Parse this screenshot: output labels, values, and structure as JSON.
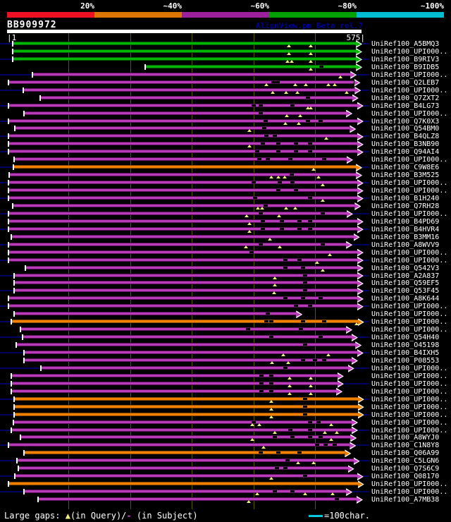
{
  "header": {
    "accession": "BB909972",
    "watermark": "AlignView.pm Beta rel.7",
    "scale_segments": [
      {
        "label": "20%",
        "color": "#ef1024"
      },
      {
        "label": "~40%",
        "color": "#dd7600"
      },
      {
        "label": "~60%",
        "color": "#9c1f9c"
      },
      {
        "label": "~80%",
        "color": "#00a000"
      },
      {
        "label": "~100%",
        "color": "#00bcd0"
      }
    ]
  },
  "ruler": {
    "start_label": "|1",
    "end_label": "575|",
    "query_length": 575,
    "tick_interval_chars": 100
  },
  "footer": {
    "gaps_prefix": "Large gaps: ",
    "gap_query_symbol": "▲",
    "gaps_mid": "(in Query)/",
    "gap_subject_symbol": "-",
    "gaps_suffix": " (in Subject)",
    "scale_legend_label": "=100char."
  },
  "chart_data": {
    "type": "alignment-overview",
    "title": "BB909972 BLAST hit overview",
    "query_length": 575,
    "x_axis": {
      "start": 1,
      "end": 575,
      "gridline_positions": [
        100,
        200,
        300,
        400,
        500
      ]
    },
    "color_meaning": {
      "green": "~80% identity",
      "purple": "~60% identity",
      "orange": "~40% identity"
    },
    "legend_scale_chars": 100,
    "gap_semantics": {
      "triangle": "large gap in Query",
      "dash": "large gap in Subject"
    },
    "rows": [
      {
        "label": "UniRef100_A5BMQ3",
        "color": "green",
        "start": 10,
        "end": 566,
        "gaps_query": [
          457,
          493
        ],
        "gaps_subject": []
      },
      {
        "label": "UniRef100_UPI000..",
        "color": "green",
        "start": 10,
        "end": 566,
        "gaps_query": [
          457,
          493
        ],
        "gaps_subject": []
      },
      {
        "label": "UniRef100_B9RIV3",
        "color": "green",
        "start": 10,
        "end": 566,
        "gaps_query": [
          455,
          462,
          493
        ],
        "gaps_subject": []
      },
      {
        "label": "UniRef100_B9IDB5",
        "color": "green",
        "start": 225,
        "end": 566,
        "gaps_query": [
          493
        ],
        "gaps_subject": [
          510
        ]
      },
      {
        "label": "UniRef100_UPI000..",
        "color": "purple",
        "start": 42,
        "end": 557,
        "gaps_query": [
          541
        ],
        "gaps_subject": []
      },
      {
        "label": "UniRef100_Q2LEB7",
        "color": "purple",
        "start": 3,
        "end": 563,
        "gaps_query": [
          421,
          468,
          485,
          521,
          531
        ],
        "gaps_subject": [
          432,
          439
        ]
      },
      {
        "label": "UniRef100_UPI000..",
        "color": "purple",
        "start": 27,
        "end": 564,
        "gaps_query": [
          431,
          453,
          471,
          551
        ],
        "gaps_subject": []
      },
      {
        "label": "UniRef100_Q7ZXT2",
        "color": "purple",
        "start": 55,
        "end": 560,
        "gaps_query": [],
        "gaps_subject": [
          488
        ]
      },
      {
        "label": "UniRef100_B4LG73",
        "color": "purple",
        "start": 3,
        "end": 568,
        "gaps_query": [
          488,
          493
        ],
        "gaps_subject": [
          400,
          412,
          463
        ]
      },
      {
        "label": "UniRef100_UPI000..",
        "color": "purple",
        "start": 29,
        "end": 550,
        "gaps_query": [
          454,
          476
        ],
        "gaps_subject": [
          412
        ]
      },
      {
        "label": "UniRef100_Q7K0X3",
        "color": "purple",
        "start": 3,
        "end": 568,
        "gaps_query": [
          452,
          473
        ],
        "gaps_subject": [
          420,
          488,
          509
        ]
      },
      {
        "label": "UniRef100_Q54BM0",
        "color": "purple",
        "start": 14,
        "end": 556,
        "gaps_query": [
          393
        ],
        "gaps_subject": [
          417
        ]
      },
      {
        "label": "UniRef100_B4QLZ8",
        "color": "purple",
        "start": 3,
        "end": 568,
        "gaps_query": [
          518
        ],
        "gaps_subject": [
          421,
          434
        ]
      },
      {
        "label": "UniRef100_B3NB90",
        "color": "purple",
        "start": 3,
        "end": 568,
        "gaps_query": [
          393
        ],
        "gaps_subject": [
          415,
          440,
          469,
          492
        ]
      },
      {
        "label": "UniRef100_Q94AI4",
        "color": "purple",
        "start": 3,
        "end": 568,
        "gaps_query": [],
        "gaps_subject": [
          406,
          440,
          469,
          492
        ]
      },
      {
        "label": "UniRef100_UPI000..",
        "color": "purple",
        "start": 13,
        "end": 551,
        "gaps_query": [],
        "gaps_subject": [
          409,
          423,
          460,
          514
        ]
      },
      {
        "label": "UniRef100_C9W8E6",
        "color": "orange",
        "start": 11,
        "end": 566,
        "gaps_query": [
          497
        ],
        "gaps_subject": []
      },
      {
        "label": "UniRef100_B3M525",
        "color": "purple",
        "start": 5,
        "end": 566,
        "gaps_query": [
          429,
          440,
          450,
          505
        ],
        "gaps_subject": [
          462
        ]
      },
      {
        "label": "UniRef100_UPI000..",
        "color": "purple",
        "start": 3,
        "end": 568,
        "gaps_query": [
          512
        ],
        "gaps_subject": [
          400,
          442,
          463
        ]
      },
      {
        "label": "UniRef100_UPI000..",
        "color": "purple",
        "start": 3,
        "end": 568,
        "gaps_query": [],
        "gaps_subject": [
          440,
          469
        ]
      },
      {
        "label": "UniRef100_B1H240",
        "color": "purple",
        "start": 3,
        "end": 568,
        "gaps_query": [
          512
        ],
        "gaps_subject": [
          402,
          492
        ]
      },
      {
        "label": "UniRef100_Q7RH28",
        "color": "purple",
        "start": 10,
        "end": 564,
        "gaps_query": [
          407,
          414,
          453,
          468
        ],
        "gaps_subject": [
          420
        ]
      },
      {
        "label": "UniRef100_UPI000..",
        "color": "purple",
        "start": 3,
        "end": 551,
        "gaps_query": [
          389,
          441
        ],
        "gaps_subject": [
          412,
          512
        ]
      },
      {
        "label": "UniRef100_B4PD69",
        "color": "purple",
        "start": 3,
        "end": 568,
        "gaps_query": [
          393
        ],
        "gaps_subject": [
          415,
          446,
          474,
          492
        ]
      },
      {
        "label": "UniRef100_B4HVR4",
        "color": "purple",
        "start": 3,
        "end": 568,
        "gaps_query": [
          393
        ],
        "gaps_subject": [
          415,
          446,
          474,
          492
        ]
      },
      {
        "label": "UniRef100_B3MM16",
        "color": "purple",
        "start": 8,
        "end": 562,
        "gaps_query": [
          426
        ],
        "gaps_subject": []
      },
      {
        "label": "UniRef100_A8WVV9",
        "color": "purple",
        "start": 3,
        "end": 550,
        "gaps_query": [
          388,
          442
        ],
        "gaps_subject": [
          412,
          512
        ]
      },
      {
        "label": "UniRef100_UPI000..",
        "color": "purple",
        "start": 3,
        "end": 568,
        "gaps_query": [
          524
        ],
        "gaps_subject": [
          397
        ]
      },
      {
        "label": "UniRef100_UPI000..",
        "color": "purple",
        "start": 3,
        "end": 568,
        "gaps_query": [
          503
        ],
        "gaps_subject": [
          452,
          474
        ]
      },
      {
        "label": "UniRef100_Q542V3",
        "color": "purple",
        "start": 31,
        "end": 568,
        "gaps_query": [
          512
        ],
        "gaps_subject": [
          452,
          480
        ]
      },
      {
        "label": "UniRef100_A2A837",
        "color": "purple",
        "start": 13,
        "end": 568,
        "gaps_query": [
          434
        ],
        "gaps_subject": [
          483
        ]
      },
      {
        "label": "UniRef100_Q59EF5",
        "color": "purple",
        "start": 13,
        "end": 568,
        "gaps_query": [
          434
        ],
        "gaps_subject": [
          483
        ]
      },
      {
        "label": "UniRef100_Q53F45",
        "color": "purple",
        "start": 13,
        "end": 568,
        "gaps_query": [
          433
        ],
        "gaps_subject": [
          483
        ]
      },
      {
        "label": "UniRef100_A8K644",
        "color": "purple",
        "start": 3,
        "end": 568,
        "gaps_query": [],
        "gaps_subject": [
          452,
          480,
          509
        ]
      },
      {
        "label": "UniRef100_UPI000..",
        "color": "purple",
        "start": 3,
        "end": 568,
        "gaps_query": [],
        "gaps_subject": [
          469,
          492
        ]
      },
      {
        "label": "UniRef100_UPI000..",
        "color": "purple",
        "start": 13,
        "end": 469,
        "gaps_query": [],
        "gaps_subject": [
          423
        ]
      },
      {
        "label": "UniRef100_UPI000..",
        "color": "orange",
        "start": 8,
        "end": 569,
        "gaps_query": [
          567
        ],
        "gaps_subject": [
          421,
          429,
          480,
          514
        ]
      },
      {
        "label": "UniRef100_UPI000..",
        "color": "purple",
        "start": 23,
        "end": 550,
        "gaps_query": [],
        "gaps_subject": [
          391,
          477
        ]
      },
      {
        "label": "UniRef100_Q54H40",
        "color": "purple",
        "start": 26,
        "end": 559,
        "gaps_query": [],
        "gaps_subject": [
          429,
          509
        ]
      },
      {
        "label": "UniRef100_O45198",
        "color": "purple",
        "start": 16,
        "end": 565,
        "gaps_query": [],
        "gaps_subject": [
          483
        ]
      },
      {
        "label": "UniRef100_B4IXH5",
        "color": "purple",
        "start": 29,
        "end": 568,
        "gaps_query": [
          448,
          521
        ],
        "gaps_subject": []
      },
      {
        "label": "UniRef100_P08553",
        "color": "purple",
        "start": 29,
        "end": 559,
        "gaps_query": [
          430,
          456
        ],
        "gaps_subject": [
          480,
          500,
          514
        ]
      },
      {
        "label": "UniRef100_UPI000..",
        "color": "purple",
        "start": 56,
        "end": 553,
        "gaps_query": [],
        "gaps_subject": [
          452
        ]
      },
      {
        "label": "UniRef100_UPI000..",
        "color": "purple",
        "start": 8,
        "end": 536,
        "gaps_query": [
          458,
          493
        ],
        "gaps_subject": [
          413,
          429
        ]
      },
      {
        "label": "UniRef100_UPI000..",
        "color": "purple",
        "start": 8,
        "end": 536,
        "gaps_query": [
          458,
          493
        ],
        "gaps_subject": [
          413,
          429
        ]
      },
      {
        "label": "UniRef100_UPI000..",
        "color": "purple",
        "start": 8,
        "end": 534,
        "gaps_query": [
          458,
          493
        ],
        "gaps_subject": [
          413,
          429
        ]
      },
      {
        "label": "UniRef100_UPI000..",
        "color": "orange",
        "start": 13,
        "end": 569,
        "gaps_query": [
          429
        ],
        "gaps_subject": [
          483
        ]
      },
      {
        "label": "UniRef100_UPI000..",
        "color": "orange",
        "start": 13,
        "end": 569,
        "gaps_query": [
          429
        ],
        "gaps_subject": [
          483
        ]
      },
      {
        "label": "UniRef100_UPI000..",
        "color": "orange",
        "start": 13,
        "end": 569,
        "gaps_query": [
          429
        ],
        "gaps_subject": [
          483
        ]
      },
      {
        "label": "UniRef100_UPI000..",
        "color": "purple",
        "start": 11,
        "end": 559,
        "gaps_query": [
          398,
          409,
          526
        ],
        "gaps_subject": [
          400,
          492,
          505
        ]
      },
      {
        "label": "UniRef100_UPI000..",
        "color": "purple",
        "start": 8,
        "end": 559,
        "gaps_query": [
          434,
          516,
          535
        ],
        "gaps_subject": [
          460,
          492
        ]
      },
      {
        "label": "UniRef100_A8WYJ0",
        "color": "purple",
        "start": 23,
        "end": 557,
        "gaps_query": [
          398,
          526
        ],
        "gaps_subject": [
          434,
          463,
          492,
          509
        ]
      },
      {
        "label": "UniRef100_C1N8Y8",
        "color": "purple",
        "start": 3,
        "end": 556,
        "gaps_query": [
          416
        ],
        "gaps_subject": [
          503,
          517,
          532
        ]
      },
      {
        "label": "UniRef100_Q06A99",
        "color": "orange",
        "start": 29,
        "end": 548,
        "gaps_query": [],
        "gaps_subject": [
          412,
          440,
          474
        ]
      },
      {
        "label": "UniRef100_C5LGN6",
        "color": "purple",
        "start": 17,
        "end": 562,
        "gaps_query": [
          472,
          497
        ],
        "gaps_subject": [
          455
        ]
      },
      {
        "label": "UniRef100_Q7S6C9",
        "color": "purple",
        "start": 19,
        "end": 553,
        "gaps_query": [],
        "gaps_subject": [
          438,
          452
        ]
      },
      {
        "label": "UniRef100_Q08170",
        "color": "purple",
        "start": 14,
        "end": 568,
        "gaps_query": [
          429
        ],
        "gaps_subject": [
          483
        ]
      },
      {
        "label": "UniRef100_UPI000..",
        "color": "orange",
        "start": 3,
        "end": 569,
        "gaps_query": [],
        "gaps_subject": []
      },
      {
        "label": "UniRef100_UPI000..",
        "color": "purple",
        "start": 29,
        "end": 550,
        "gaps_query": [
          406,
          483,
          528
        ],
        "gaps_subject": [
          434,
          463
        ]
      },
      {
        "label": "UniRef100_A7MB38",
        "color": "purple",
        "start": 51,
        "end": 567,
        "gaps_query": [
          392
        ],
        "gaps_subject": [
          535
        ]
      }
    ]
  }
}
